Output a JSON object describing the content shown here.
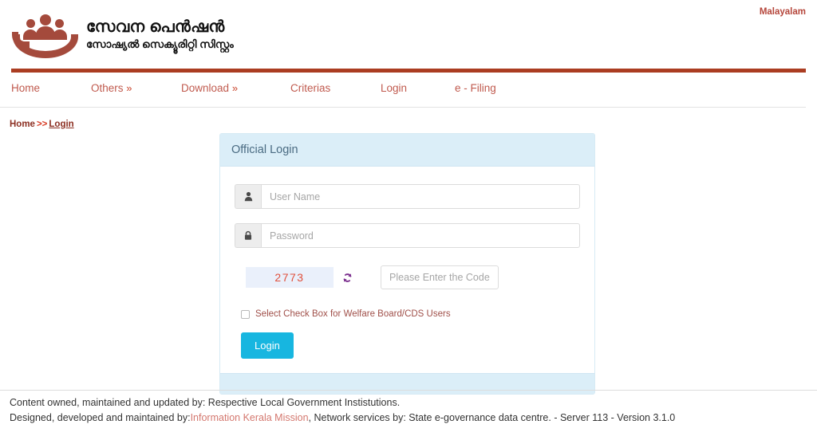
{
  "topbar": {
    "language_link": "Malayalam"
  },
  "header": {
    "title_malayalam": "സേവന പെൻഷൻ",
    "subtitle_malayalam": "സോഷ്യൽ സെക്യൂരിറ്റി സിസ്റ്റം",
    "logo_icon": "hand-holding-people-icon",
    "accent_color": "#ab3d22"
  },
  "nav": {
    "items": [
      {
        "label": "Home",
        "caret": ""
      },
      {
        "label": "Others",
        "caret": "»"
      },
      {
        "label": "Download",
        "caret": "»"
      },
      {
        "label": "Criterias",
        "caret": ""
      },
      {
        "label": "Login",
        "caret": ""
      },
      {
        "label": "e - Filing",
        "caret": ""
      }
    ]
  },
  "breadcrumb": {
    "home": "Home",
    "separator": ">>",
    "current": "Login"
  },
  "login_panel": {
    "heading": "Official Login",
    "username": {
      "placeholder": "User Name",
      "value": "",
      "icon": "user-icon"
    },
    "password": {
      "placeholder": "Password",
      "value": "",
      "icon": "lock-icon"
    },
    "captcha": {
      "code": "2773",
      "refresh_icon": "refresh-icon",
      "input_placeholder": "Please Enter the Code:",
      "input_value": "",
      "code_color": "#e0503c",
      "box_background": "#eaf0fb"
    },
    "checkbox": {
      "label": "Select Check Box for Welfare Board/CDS Users",
      "checked": false
    },
    "submit_label": "Login",
    "submit_color": "#17b6e0",
    "header_background": "#dbeef8"
  },
  "footer": {
    "line1": "Content owned, maintained and updated by: Respective Local Government Instistutions.",
    "line2_prefix": "Designed, developed and maintained by:",
    "line2_link": "Information Kerala Mission",
    "line2_suffix": ", Network services by: State e-governance data centre. - Server 113 - Version 3.1.0",
    "link_color": "#d4786f"
  }
}
